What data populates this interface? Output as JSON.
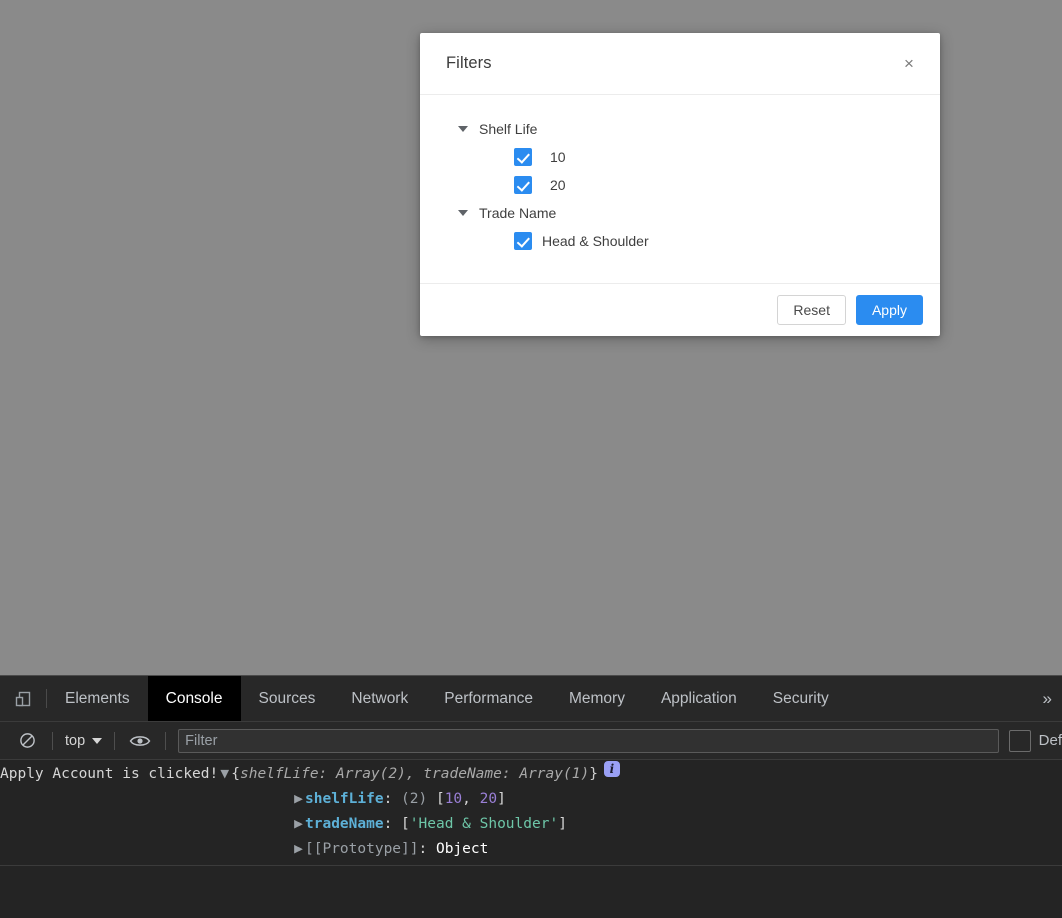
{
  "theme": {
    "backdrop": "#8a8a8a",
    "accent": "#2b8cf0",
    "devtools_bg": "#242424",
    "devtools_tabbar_bg": "#282828",
    "selected_tab_bg": "#000000"
  },
  "modal": {
    "title": "Filters",
    "close_icon": "×",
    "groups": [
      {
        "label": "Shelf Life",
        "expanded": true,
        "options": [
          {
            "label": "10",
            "checked": true
          },
          {
            "label": "20",
            "checked": true
          }
        ]
      },
      {
        "label": "Trade Name",
        "expanded": true,
        "options": [
          {
            "label": "Head & Shoulder",
            "checked": true
          }
        ]
      }
    ],
    "footer": {
      "reset_label": "Reset",
      "apply_label": "Apply"
    }
  },
  "devtools": {
    "tabs": [
      {
        "label": "Elements",
        "selected": false
      },
      {
        "label": "Console",
        "selected": true
      },
      {
        "label": "Sources",
        "selected": false
      },
      {
        "label": "Network",
        "selected": false
      },
      {
        "label": "Performance",
        "selected": false
      },
      {
        "label": "Memory",
        "selected": false
      },
      {
        "label": "Application",
        "selected": false
      },
      {
        "label": "Security",
        "selected": false
      }
    ],
    "more_tabs_icon": "»",
    "toolbar": {
      "clear_icon": "clear-console-icon",
      "context_value": "top",
      "eye_icon": "live-expression-icon",
      "filter_placeholder": "Filter",
      "filter_value": "",
      "levels_label": "Def"
    },
    "console": {
      "message": "Apply Account is clicked!",
      "object_preview": {
        "open_brace": "{",
        "close_brace": "}",
        "text": "shelfLife: Array(2), tradeName: Array(1)",
        "badge": "i",
        "disclosure": "▼"
      },
      "properties": [
        {
          "disclosure": "▶",
          "key": "shelfLife",
          "key_style": "highlight",
          "separator": ": ",
          "length": "(2) ",
          "open": "[",
          "values": [
            "10",
            "20"
          ],
          "value_style": "number",
          "close": "]"
        },
        {
          "disclosure": "▶",
          "key": "tradeName",
          "key_style": "highlight",
          "separator": ": ",
          "length": "",
          "open": "[",
          "values": [
            "'Head & Shoulder'"
          ],
          "value_style": "string",
          "close": "]"
        },
        {
          "disclosure": "▶",
          "key": "[[Prototype]]",
          "key_style": "plain",
          "separator": ": ",
          "length": "",
          "open": "",
          "values": [
            "Object"
          ],
          "value_style": "object",
          "close": ""
        }
      ]
    }
  }
}
